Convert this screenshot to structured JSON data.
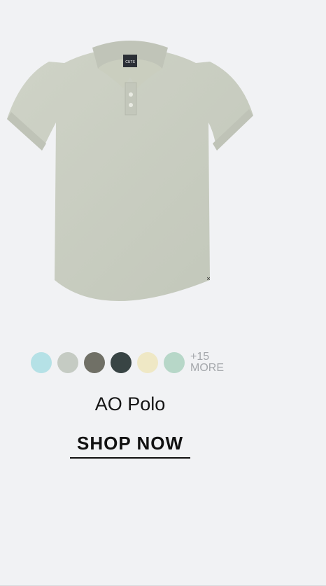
{
  "product": {
    "name": "AO Polo",
    "cta_label": "SHOP NOW",
    "tag_logo_text": "CUTS",
    "swatches": [
      {
        "color": "#b5e1e6"
      },
      {
        "color": "#c5cbc3"
      },
      {
        "color": "#707066"
      },
      {
        "color": "#384444"
      },
      {
        "color": "#efe8c5"
      },
      {
        "color": "#b7d7c8"
      }
    ],
    "more_count": "+15",
    "more_label": "MORE",
    "shirt_color": "#c7cbbf"
  }
}
